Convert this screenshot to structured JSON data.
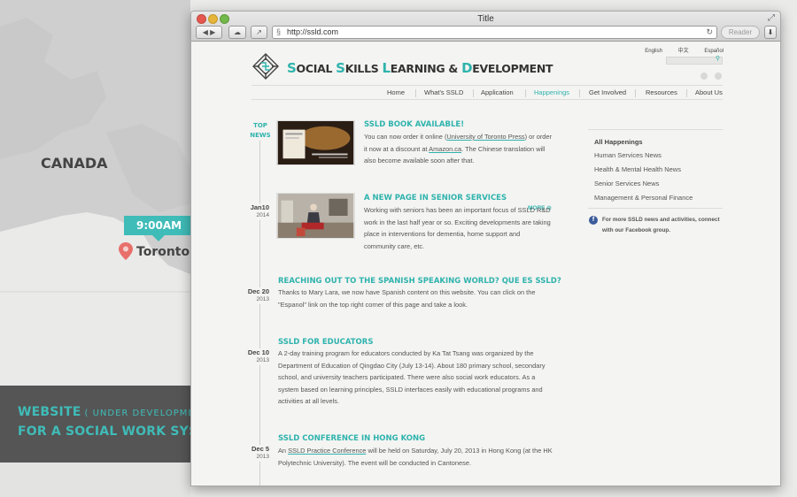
{
  "scene": {
    "country": "CANADA",
    "time": "9:00AM",
    "city": "Toronto",
    "promo_line1": "WEBSITE",
    "promo_note": "( UNDER DEVELOPMENT )",
    "promo_line2": "FOR A SOCIAL WORK SYSTEM",
    "accent_color": "#3fbcb8"
  },
  "browser": {
    "title": "Title",
    "url": "http://ssld.com",
    "reader_label": "Reader"
  },
  "site": {
    "languages": [
      "English",
      "中文",
      "Español"
    ],
    "title_parts": {
      "s": "S",
      "ocial": "OCIAL ",
      "s2": "S",
      "kills": "KILLS ",
      "l": "L",
      "earning": "EARNING & ",
      "d": "D",
      "evelopment": "EVELOPMENT"
    },
    "nav": [
      "Home",
      "What's SSLD",
      "Application",
      "Happenings",
      "Get Involved",
      "Resources",
      "About Us"
    ],
    "active_nav": "Happenings",
    "top_news_label": "TOP NEWS",
    "more_label": "MORE",
    "news": [
      {
        "headline": "SSLD BOOK AVAILABLE!",
        "text_a": "You can now order it online (",
        "link_a": "University of Toronto Press",
        "text_b": ") or order it now at a discount at ",
        "link_b": "Amazon.ca",
        "text_c": ". The Chinese translation will also become available soon after that."
      },
      {
        "date": "Jan10",
        "year": "2014",
        "headline": "A NEW PAGE IN SENIOR SERVICES",
        "text": "Working with seniors has been an important focus of SSLD R&D work in the last half year or so. Exciting developments are taking place in interventions for dementia, home support and community care, etc."
      },
      {
        "date": "Dec 20",
        "year": "2013",
        "headline": "REACHING OUT TO THE SPANISH SPEAKING WORLD? QUE ES SSLD?",
        "text": "Thanks to Mary Lara, we now have Spanish content on this website. You can click on the \"Espanol\" link on the top right corner of this page and take a look."
      },
      {
        "date": "Dec 10",
        "year": "2013",
        "headline": "SSLD FOR EDUCATORS",
        "text": "A 2-day training program for educators conducted by Ka Tat Tsang was organized by the Department of Education of Qingdao City (July 13-14). About 180 primary school, secondary school, and university teachers participated. There were also social work educators. As a system based on learning principles, SSLD interfaces easily with educational programs and activities at all levels."
      },
      {
        "date": "Dec 5",
        "year": "2013",
        "headline": "SSLD CONFERENCE IN HONG KONG",
        "text_a": "An ",
        "link_a": "SSLD Practice Conference",
        "text_b": " will be held on Saturday, July 20, 2013 in Hong Kong (at the HK Polytechnic University). The event will be conducted in Cantonese."
      }
    ],
    "sidebar": {
      "heading": "All Happenings",
      "items": [
        "Human Services News",
        "Health & Mental Health News",
        "Senior Services News",
        "Management & Personal Finance"
      ],
      "facebook_text": "For more SSLD news and activities, connect with our Facebook group."
    }
  }
}
